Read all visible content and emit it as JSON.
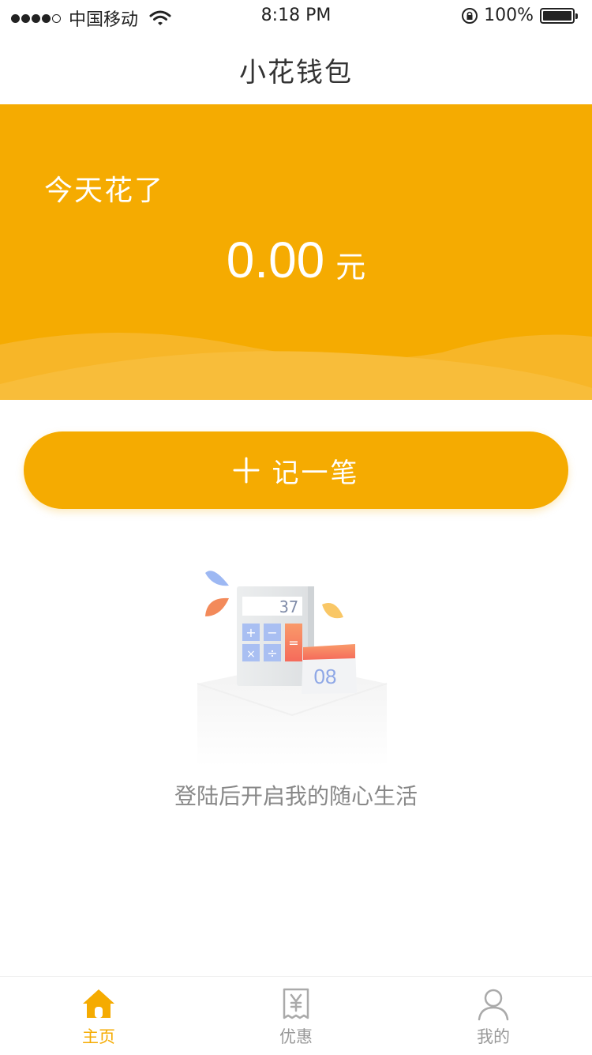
{
  "status_bar": {
    "carrier": "中国移动",
    "time": "8:18 PM",
    "battery": "100%"
  },
  "nav": {
    "title": "小花钱包"
  },
  "hero": {
    "label": "今天花了",
    "amount": "0.00",
    "unit": "元"
  },
  "add_button": {
    "label": "记一笔"
  },
  "illustration": {
    "calc_display": "37",
    "calendar_day": "08"
  },
  "empty_state": {
    "text": "登陆后开启我的随心生活"
  },
  "tabs": [
    {
      "label": "主页",
      "icon": "home-icon",
      "active": true
    },
    {
      "label": "优惠",
      "icon": "coupon-icon",
      "active": false
    },
    {
      "label": "我的",
      "icon": "user-icon",
      "active": false
    }
  ],
  "colors": {
    "accent": "#f5ab01",
    "inactive": "#999999"
  }
}
